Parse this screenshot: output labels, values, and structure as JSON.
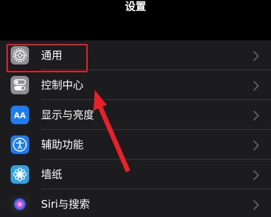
{
  "nav": {
    "title": "设置"
  },
  "colors": {
    "background": "#000000",
    "cell": "#1c1c1e",
    "separator": "#38383a",
    "chevron": "#636366",
    "annotation": "#e8202a"
  },
  "settings": [
    {
      "label": "通用",
      "icon": "gear-icon",
      "icon_bg": "#8e8e93"
    },
    {
      "label": "控制中心",
      "icon": "toggles-icon",
      "icon_bg": "#8e8e93"
    },
    {
      "label": "显示与亮度",
      "icon": "text-size-icon",
      "icon_text": "AA",
      "icon_bg": "#1e7cf2"
    },
    {
      "label": "辅助功能",
      "icon": "accessibility-icon",
      "icon_bg": "#1e7cf2"
    },
    {
      "label": "墙纸",
      "icon": "flower-icon",
      "icon_bg": "#2fa3e6"
    },
    {
      "label": "Siri与搜索",
      "icon": "siri-icon",
      "icon_bg": "#222222"
    }
  ],
  "annotations": [
    {
      "type": "highlight-box",
      "target": "通用",
      "color": "#e8202a"
    },
    {
      "type": "arrow",
      "target": "控制中心",
      "color": "#e8202a"
    }
  ]
}
